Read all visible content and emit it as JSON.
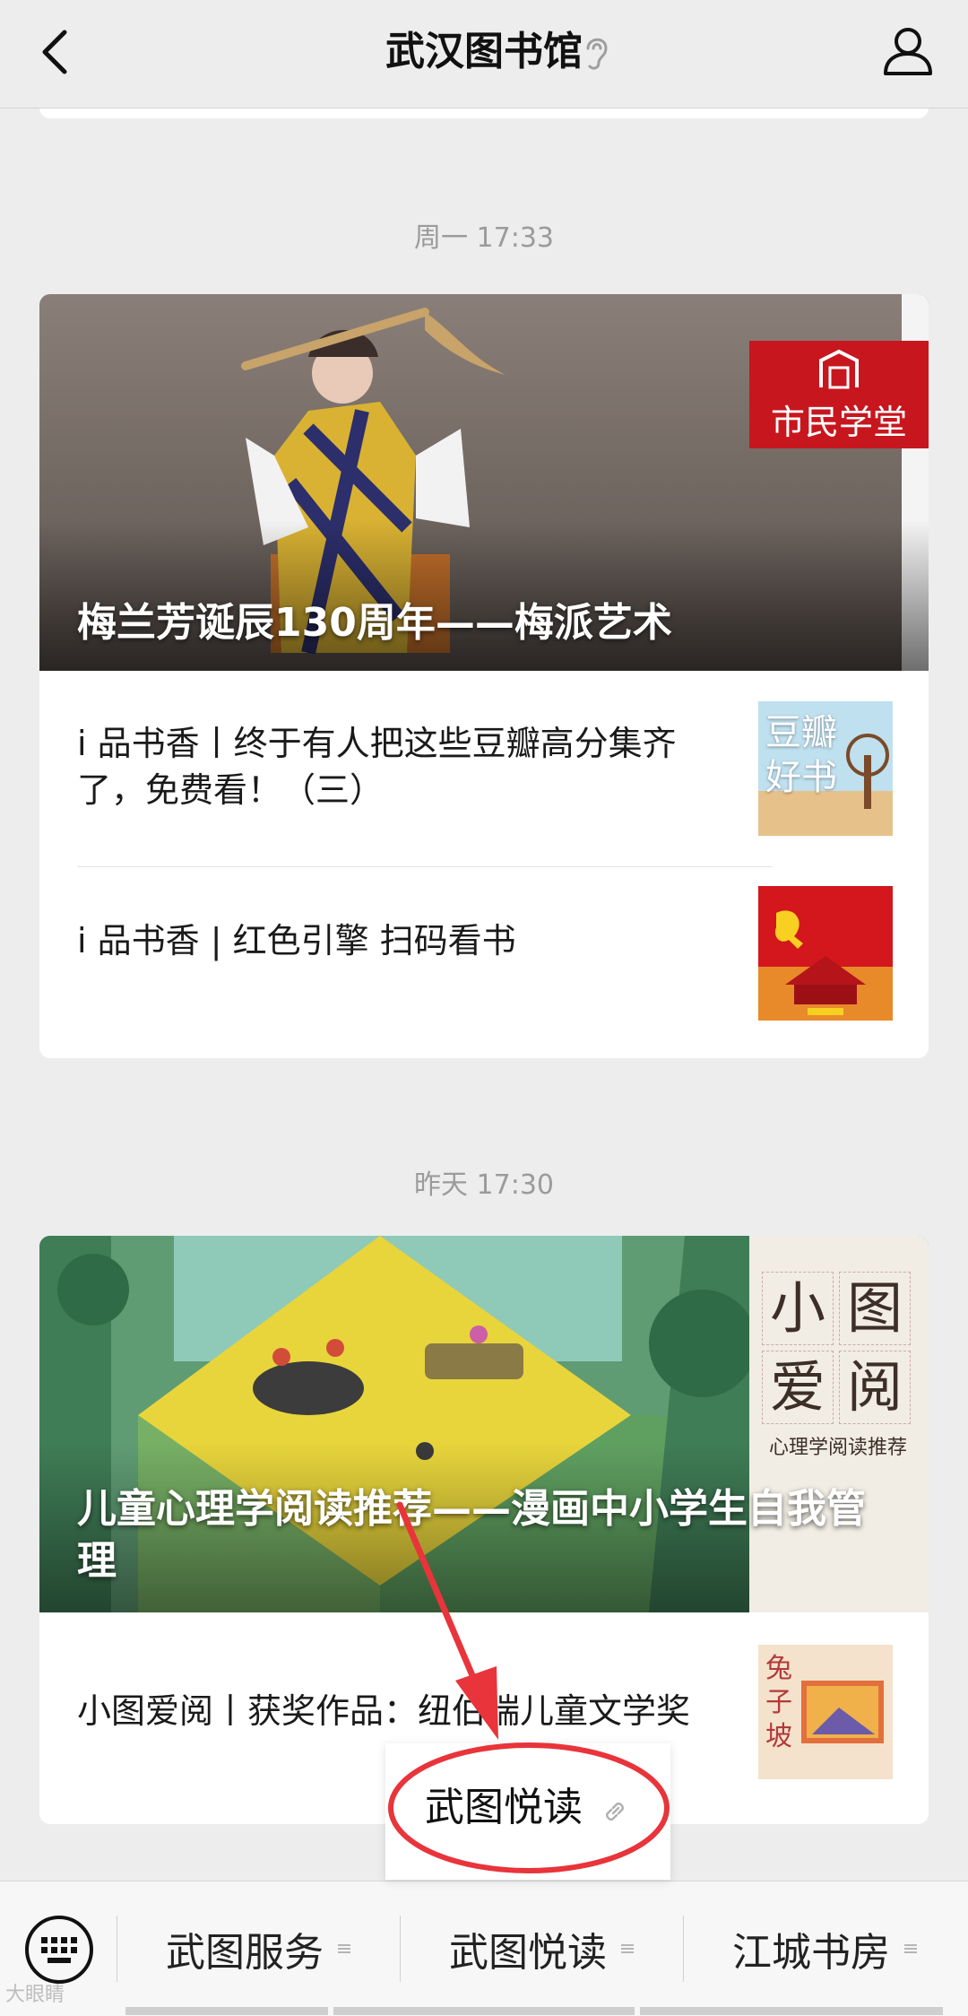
{
  "header": {
    "title": "武汉图书馆",
    "back_icon": "chevron-left-icon",
    "listen_icon": "ear-icon",
    "profile_icon": "person-icon"
  },
  "messages": [
    {
      "timestamp": "周一 17:33",
      "cover": {
        "title": "梅兰芳诞辰130周年——梅派艺术",
        "badge": "市民学堂"
      },
      "items": [
        {
          "title": "i 品书香丨终于有人把这些豆瓣高分集齐了，免费看！（三）",
          "thumb_text": "豆瓣好书"
        },
        {
          "title": "i 品书香 | 红色引擎 扫码看书",
          "thumb_text": ""
        }
      ]
    },
    {
      "timestamp": "昨天 17:30",
      "cover": {
        "title": "儿童心理学阅读推荐——漫画中小学生自我管理",
        "badge_chars": [
          "小",
          "图",
          "爱",
          "阅"
        ],
        "badge_sub": "心理学阅读推荐"
      },
      "items": [
        {
          "title": "小图爱阅丨获奖作品：纽伯瑞儿童文学奖",
          "thumb_text": "兔子坡"
        }
      ]
    }
  ],
  "popup": {
    "label": "武图悦读",
    "icon": "link-icon"
  },
  "menu": {
    "keyboard_icon": "keyboard-icon",
    "items": [
      {
        "label": "武图服务"
      },
      {
        "label": "武图悦读"
      },
      {
        "label": "江城书房"
      }
    ]
  },
  "watermark": "大眼睛",
  "colors": {
    "background": "#ededed",
    "annotation_red": "#e8343a",
    "badge_red": "#c8161e"
  }
}
